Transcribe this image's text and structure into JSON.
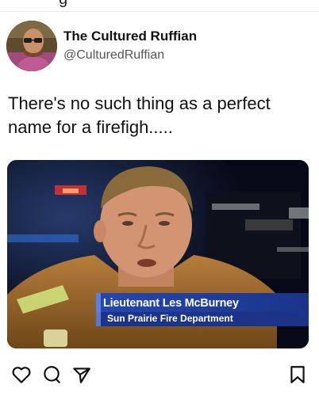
{
  "profile": {
    "name": "The Cultured Ruffian",
    "handle": "@CulturedRuffian"
  },
  "tweet": {
    "text": "There's no such thing as a perfect name for a firefigh....."
  },
  "media": {
    "caption_name": "Lieutenant Les McBurney",
    "caption_department": "Sun Prairie Fire Department"
  },
  "actions": {
    "icons": [
      "heart-icon",
      "comment-icon",
      "share-icon",
      "bookmark-icon"
    ]
  },
  "colors": {
    "text_primary": "#111111",
    "text_secondary": "#555555",
    "lower_third_blue": "#1f3f9a"
  }
}
